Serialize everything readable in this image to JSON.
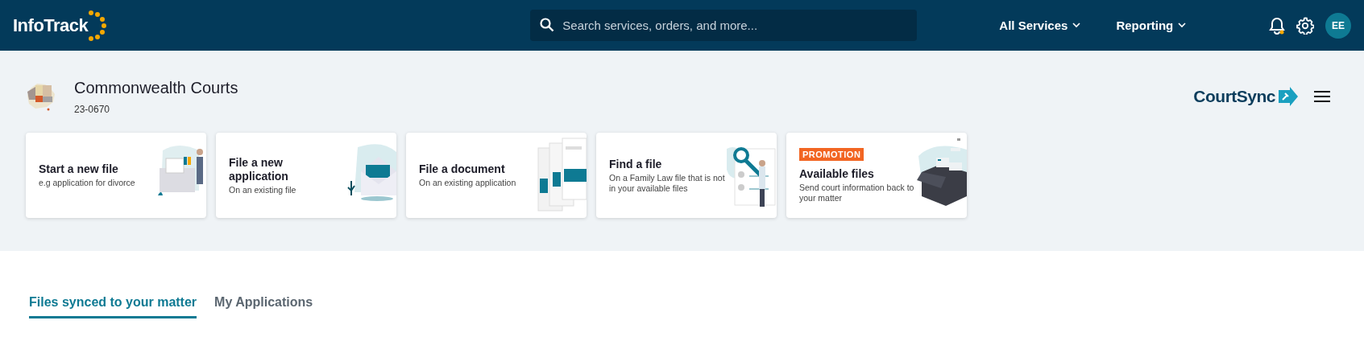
{
  "header": {
    "logo": "InfoTrack",
    "search": {
      "placeholder": "Search services, orders, and more..."
    },
    "nav": [
      {
        "label": "All Services"
      },
      {
        "label": "Reporting"
      }
    ],
    "notifications": {
      "unread": true
    },
    "avatar": "EE"
  },
  "court": {
    "title": "Commonwealth Courts",
    "matter": "23-0670",
    "brand": "CourtSync"
  },
  "cards": [
    {
      "kind": "folder",
      "title": "Start a new file",
      "subtitle": "e.g application for divorce"
    },
    {
      "kind": "envelope",
      "title": "File a new application",
      "subtitle": "On an existing file"
    },
    {
      "kind": "documents",
      "title": "File a document",
      "subtitle": "On an existing application"
    },
    {
      "kind": "search",
      "title": "Find a file",
      "subtitle": "On a Family Law file that is not in your available files"
    },
    {
      "kind": "box",
      "badge": "PROMOTION",
      "title": "Available files",
      "subtitle": "Send court information back to your matter"
    }
  ],
  "tabs": [
    {
      "label": "Files synced to your matter",
      "selected": true
    },
    {
      "label": "My Applications",
      "selected": false
    }
  ]
}
